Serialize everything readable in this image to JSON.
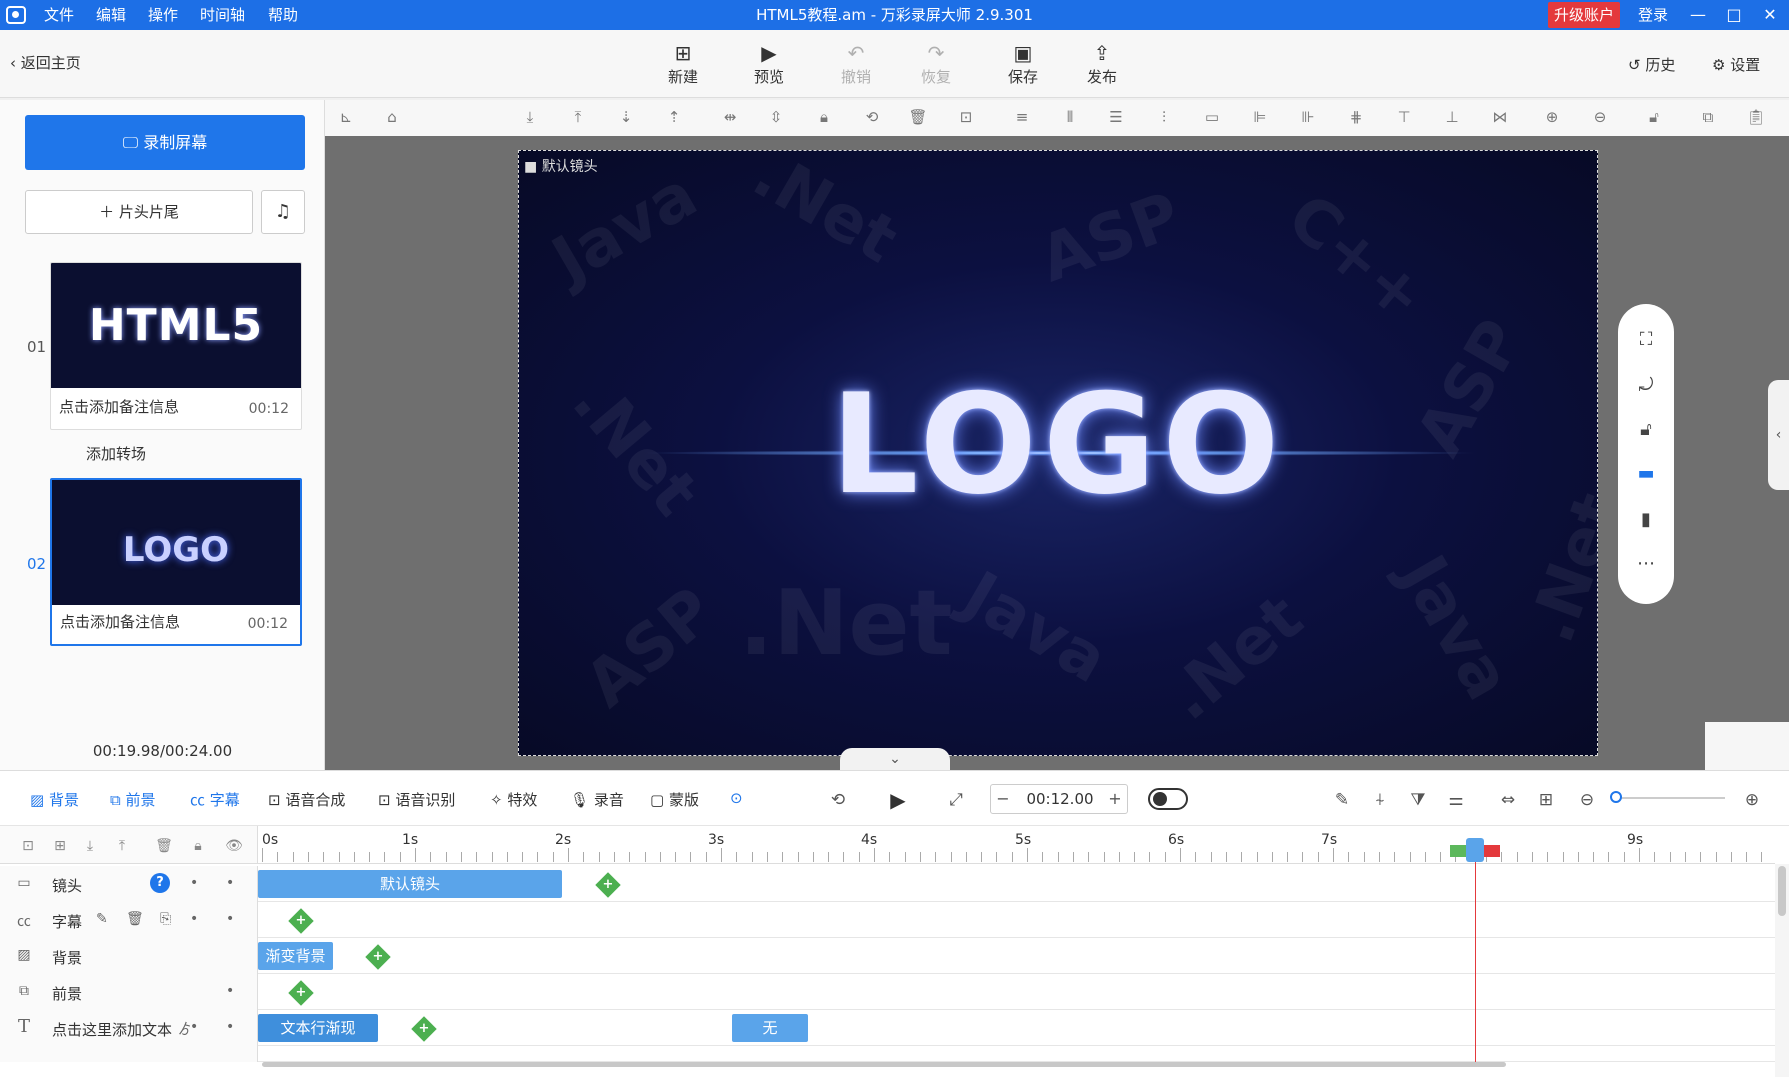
{
  "titlebar": {
    "menus": [
      "文件",
      "编辑",
      "操作",
      "时间轴",
      "帮助"
    ],
    "title": "HTML5教程.am - 万彩录屏大师 2.9.301",
    "upgrade": "升级账户",
    "login": "登录",
    "win_min": "—",
    "win_max": "□",
    "win_close": "✕"
  },
  "toolbar": {
    "back": "返回主页",
    "buttons": [
      {
        "label": "新建",
        "icon": "new-icon"
      },
      {
        "label": "预览",
        "icon": "play-icon"
      },
      {
        "label": "撤销",
        "icon": "undo-icon",
        "disabled": true
      },
      {
        "label": "恢复",
        "icon": "redo-icon",
        "disabled": true
      },
      {
        "label": "保存",
        "icon": "save-icon"
      },
      {
        "label": "发布",
        "icon": "publish-icon"
      }
    ],
    "history": "历史",
    "settings": "设置"
  },
  "left": {
    "record": "录制屏幕",
    "intro": "片头片尾",
    "scenes": [
      {
        "num": "01",
        "thumb_text": "HTML5",
        "note": "点击添加备注信息",
        "dur": "00:12"
      },
      {
        "num": "02",
        "thumb_text": "LOGO",
        "note": "点击添加备注信息",
        "dur": "00:12"
      }
    ],
    "transition": "添加转场",
    "time": "00:19.98/00:24.00"
  },
  "canvas": {
    "camera_label": "默认镜头",
    "logo_text": "LOGO"
  },
  "timeline_toolbar": {
    "tabs": [
      "背景",
      "前景",
      "字幕",
      "语音合成",
      "语音识别",
      "特效",
      "录音",
      "蒙版"
    ],
    "time": "00:12.00",
    "minus": "−",
    "plus": "+"
  },
  "ruler": [
    "0s",
    "1s",
    "2s",
    "3s",
    "4s",
    "5s",
    "6s",
    "7s",
    "9s"
  ],
  "tracks": [
    {
      "name": "镜头",
      "clips": [
        "默认镜头"
      ]
    },
    {
      "name": "字幕",
      "clips": []
    },
    {
      "name": "背景",
      "clips": [
        "渐变背景"
      ]
    },
    {
      "name": "前景",
      "clips": []
    },
    {
      "name": "点击这里添加文本",
      "suffix": "ゟ",
      "clips": [
        "文本行渐现",
        "无"
      ]
    }
  ],
  "colors": {
    "accent": "#1f76ea",
    "titlebar": "#1d6fe6",
    "upgrade": "#e4393c",
    "playhead": "#e4393c",
    "keyframe": "#4caf50"
  }
}
